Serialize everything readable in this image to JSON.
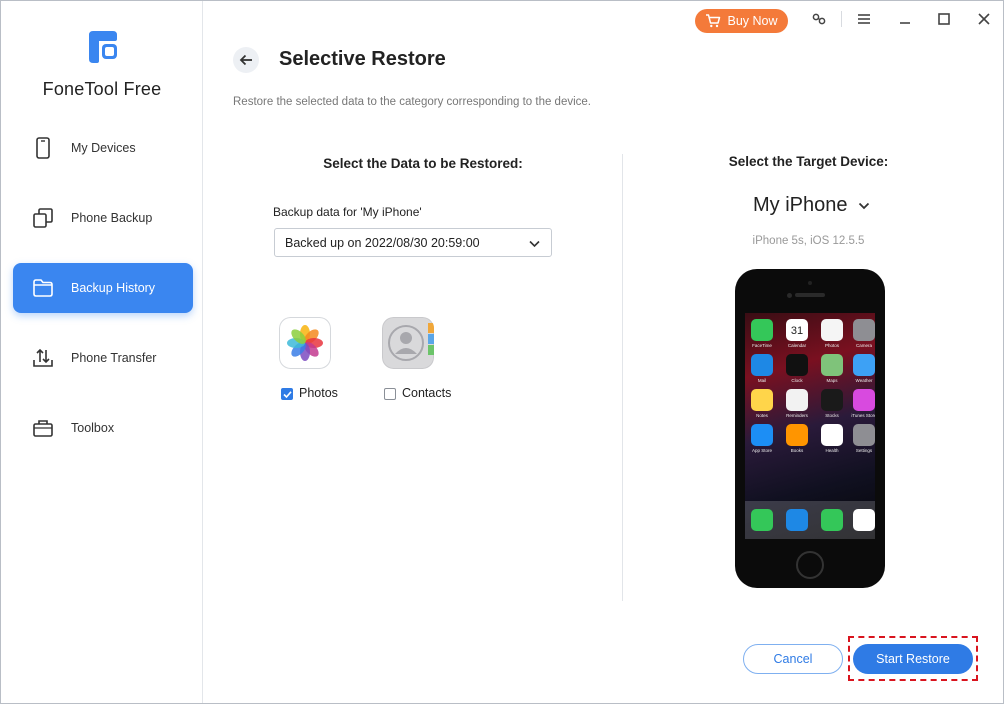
{
  "app": {
    "name": "FoneTool Free",
    "buy_now_label": "Buy Now",
    "accent_color": "#3a86f0",
    "buy_color": "#f47a3a"
  },
  "sidebar": {
    "items": [
      {
        "label": "My Devices",
        "icon": "phone-icon",
        "active": false
      },
      {
        "label": "Phone Backup",
        "icon": "copy-icon",
        "active": false
      },
      {
        "label": "Backup History",
        "icon": "folder-icon",
        "active": true
      },
      {
        "label": "Phone Transfer",
        "icon": "transfer-icon",
        "active": false
      },
      {
        "label": "Toolbox",
        "icon": "briefcase-icon",
        "active": false
      }
    ]
  },
  "header": {
    "title": "Selective Restore",
    "description": "Restore the selected data to the category corresponding to the device."
  },
  "left_panel": {
    "heading": "Select the Data to be Restored:",
    "backup_label": "Backup data for 'My iPhone'",
    "backup_selected": "Backed up on 2022/08/30 20:59:00",
    "data_items": [
      {
        "label": "Photos",
        "checked": true,
        "icon": "photos-icon"
      },
      {
        "label": "Contacts",
        "checked": false,
        "icon": "contacts-icon"
      }
    ]
  },
  "right_panel": {
    "heading": "Select the Target Device:",
    "device_name": "My iPhone",
    "device_info": "iPhone 5s, iOS 12.5.5",
    "home_apps": [
      {
        "label": "FaceTime",
        "color": "#34c759"
      },
      {
        "label": "Calendar",
        "color": "#ffffff",
        "glyph": "31"
      },
      {
        "label": "Photos",
        "color": "#f5f5f5"
      },
      {
        "label": "Camera",
        "color": "#8e8e93"
      },
      {
        "label": "Mail",
        "color": "#1e88e5"
      },
      {
        "label": "Clock",
        "color": "#111111"
      },
      {
        "label": "Maps",
        "color": "#7fc37a"
      },
      {
        "label": "Weather",
        "color": "#3da1f5"
      },
      {
        "label": "Notes",
        "color": "#ffd54a"
      },
      {
        "label": "Reminders",
        "color": "#f2f2f2"
      },
      {
        "label": "Stocks",
        "color": "#1a1a1a"
      },
      {
        "label": "iTunes Store",
        "color": "#d84adf"
      },
      {
        "label": "App Store",
        "color": "#1c8ef5"
      },
      {
        "label": "Books",
        "color": "#ff9500"
      },
      {
        "label": "Health",
        "color": "#ffffff"
      },
      {
        "label": "Settings",
        "color": "#8e8e93"
      }
    ],
    "dock_apps": [
      {
        "name": "phone",
        "color": "#34c759"
      },
      {
        "name": "safari",
        "color": "#1e88e5"
      },
      {
        "name": "messages",
        "color": "#34c759"
      },
      {
        "name": "music",
        "color": "#ffffff"
      }
    ]
  },
  "actions": {
    "cancel_label": "Cancel",
    "start_label": "Start Restore"
  }
}
